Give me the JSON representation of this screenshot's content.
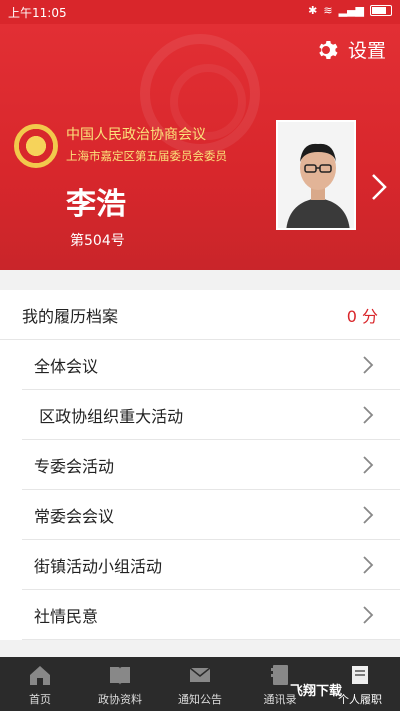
{
  "status": {
    "time": "上午11:05"
  },
  "header": {
    "settings_label": "设置",
    "org_name": "中国人民政治协商会议",
    "org_sub": "上海市嘉定区第五届委员会委员",
    "member_name": "李浩",
    "member_no": "第504号"
  },
  "records": {
    "title": "我的履历档案",
    "score": "0 分",
    "items": [
      {
        "label": "全体会议"
      },
      {
        "label": " 区政协组织重大活动"
      },
      {
        "label": "专委会活动"
      },
      {
        "label": "常委会会议"
      },
      {
        "label": "街镇活动小组活动"
      },
      {
        "label": "社情民意"
      }
    ]
  },
  "nav": {
    "items": [
      {
        "label": "首页",
        "icon": "home-icon"
      },
      {
        "label": "政协资料",
        "icon": "book-icon"
      },
      {
        "label": "通知公告",
        "icon": "mail-icon"
      },
      {
        "label": "通讯录",
        "icon": "contacts-icon"
      },
      {
        "label": "个人履职",
        "icon": "profile-icon"
      }
    ]
  },
  "watermark": {
    "text": "飞翔下载"
  },
  "colors": {
    "brand_red": "#d9262b",
    "gold": "#fbe27a",
    "nav_bg": "#2b2b2b"
  }
}
